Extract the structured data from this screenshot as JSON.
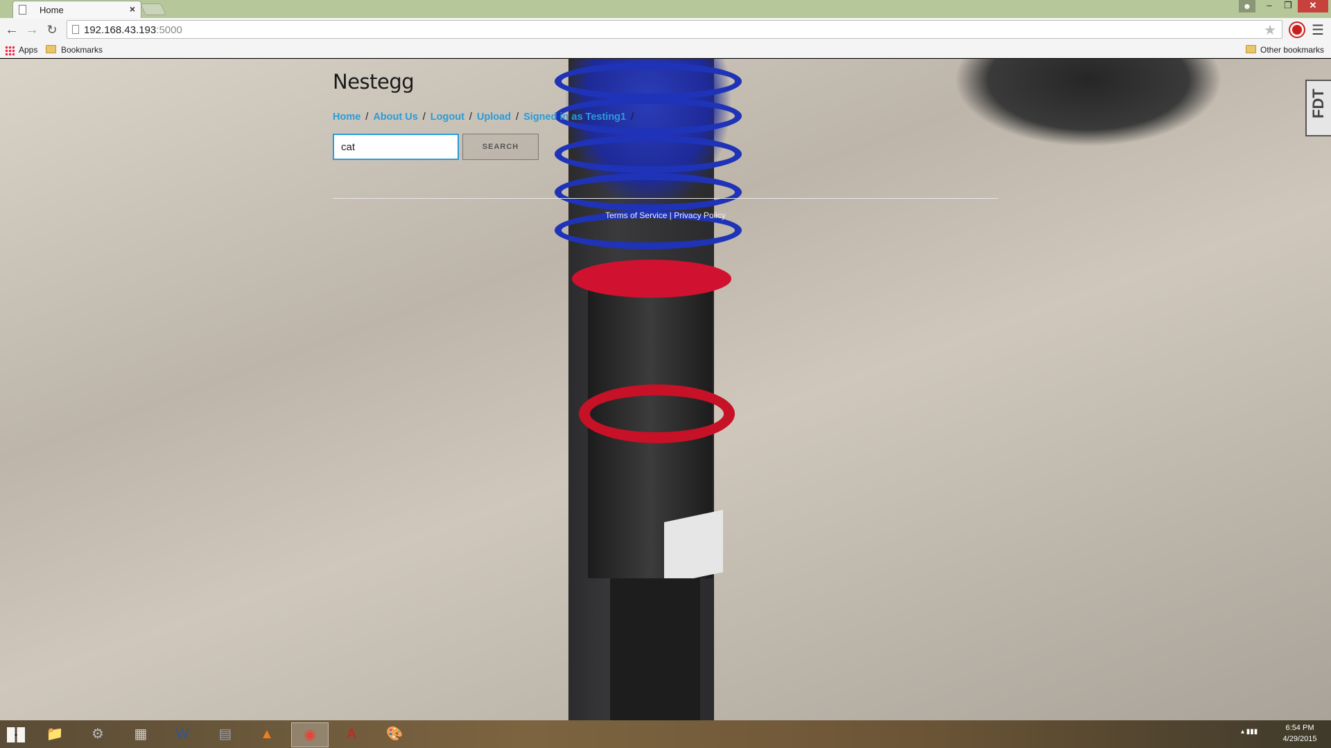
{
  "browser": {
    "tab_title": "Home",
    "tab_close": "×",
    "url_host": "192.168.43.193",
    "url_port": ":5000",
    "bookmarks_bar": {
      "apps_label": "Apps",
      "bookmarks_label": "Bookmarks",
      "other_bookmarks_label": "Other bookmarks"
    },
    "window_buttons": {
      "minimize": "–",
      "maximize": "❐",
      "close": "✕"
    },
    "icons": [
      "back-arrow-icon",
      "forward-arrow-icon",
      "reload-icon",
      "page-icon",
      "star-icon",
      "extension-icon",
      "menu-icon"
    ]
  },
  "site": {
    "title": "Nestegg",
    "nav": [
      {
        "label": "Home"
      },
      {
        "label": "About Us"
      },
      {
        "label": "Logout"
      },
      {
        "label": "Upload"
      },
      {
        "label": "Signed in as Testing1"
      }
    ],
    "nav_separator": "/",
    "search": {
      "value": "cat",
      "button_label": "SEARCH"
    },
    "footer": {
      "terms": "Terms of Service",
      "divider": "|",
      "privacy": "Privacy Policy"
    },
    "side_tab_label": "FDT"
  },
  "taskbar": {
    "apps": [
      {
        "name": "file-explorer",
        "glyph": "📁"
      },
      {
        "name": "settings",
        "glyph": "⚙"
      },
      {
        "name": "network",
        "glyph": "▦"
      },
      {
        "name": "word",
        "glyph": "W"
      },
      {
        "name": "calculator",
        "glyph": "▤"
      },
      {
        "name": "vlc",
        "glyph": "▲"
      },
      {
        "name": "chrome",
        "glyph": "◉"
      },
      {
        "name": "acrobat",
        "glyph": "A"
      },
      {
        "name": "paint",
        "glyph": "🎨"
      }
    ],
    "tray_glyph": "▴  ▮▮▮",
    "time": "6:54 PM",
    "date": "4/29/2015"
  },
  "colors": {
    "link": "#2a9cd8",
    "accent_close": "#c7413d"
  }
}
